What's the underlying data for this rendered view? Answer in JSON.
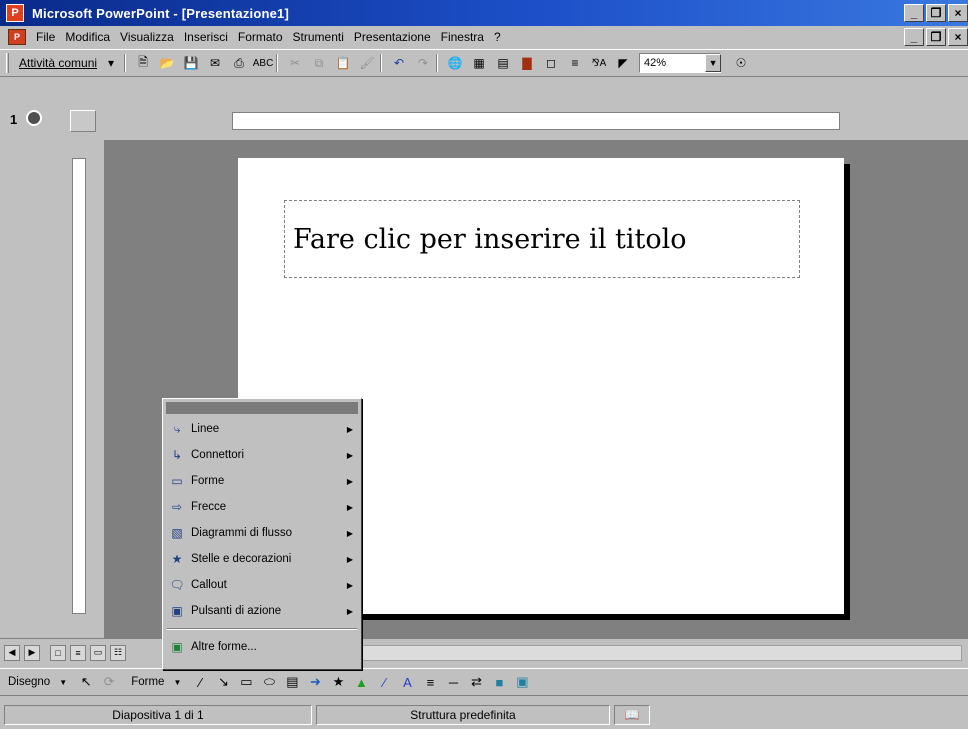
{
  "window": {
    "app_icon": "powerpoint-app-icon",
    "title": "Microsoft PowerPoint - [Presentazione1]",
    "controls": [
      "_",
      "°",
      "×"
    ]
  },
  "menubar": {
    "items": [
      "File",
      "Modifica",
      "Visualizza",
      "Inserisci",
      "Formato",
      "Strumenti",
      "Presentazione",
      "Finestra",
      "?"
    ]
  },
  "toolbar": {
    "tasks_label": "Attività comuni",
    "zoom": "42%"
  },
  "workspace": {
    "slide_number": "1",
    "title_placeholder": "Fare clic per inserire il titolo"
  },
  "context_menu": {
    "items": [
      {
        "label": "Linee",
        "icon": "lines-icon",
        "has_submenu": true
      },
      {
        "label": "Connettori",
        "icon": "connectors-icon",
        "has_submenu": true
      },
      {
        "label": "Forme",
        "icon": "basic-shapes-icon",
        "has_submenu": true
      },
      {
        "label": "Frecce",
        "icon": "block-arrows-icon",
        "has_submenu": true
      },
      {
        "label": "Diagrammi di flusso",
        "icon": "flowchart-icon",
        "has_submenu": true
      },
      {
        "label": "Stelle e decorazioni",
        "icon": "stars-banners-icon",
        "has_submenu": true
      },
      {
        "label": "Callout",
        "icon": "callouts-icon",
        "has_submenu": true
      },
      {
        "label": "Pulsanti di azione",
        "icon": "action-buttons-icon",
        "has_submenu": true
      }
    ],
    "more_shapes": "Altre forme..."
  },
  "drawbar": {
    "draw_label": "Disegno",
    "autoshapes_label": "Forme"
  },
  "statusbar": {
    "slide_info": "Diapositiva 1 di 1",
    "design": "Struttura predefinita"
  }
}
